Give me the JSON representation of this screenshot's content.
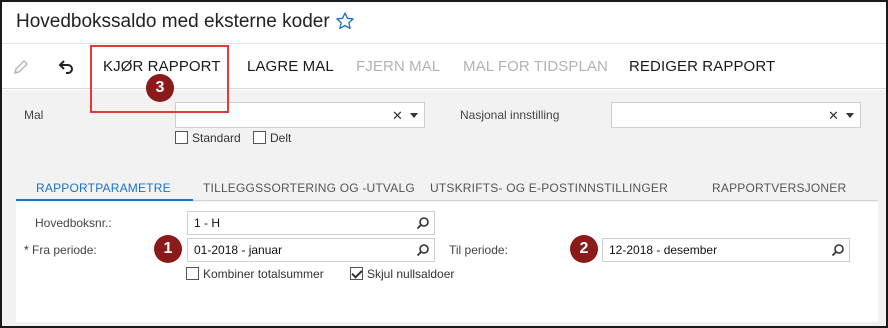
{
  "window": {
    "title": "Hovedbokssaldo med eksterne koder"
  },
  "toolbar": {
    "run_report": "KJØR RAPPORT",
    "save_template": "LAGRE MAL",
    "remove_template": "FJERN MAL",
    "schedule_template": "MAL FOR TIDSPLAN",
    "edit_report": "REDIGER RAPPORT"
  },
  "template_panel": {
    "template_label": "Mal",
    "template_value": "",
    "national_label": "Nasjonal innstilling",
    "national_value": "",
    "clear_symbol": "✕",
    "standard_label": "Standard",
    "shared_label": "Delt"
  },
  "tabs": [
    {
      "label": "RAPPORTPARAMETRE",
      "active": true
    },
    {
      "label": "TILLEGGSSORTERING OG -UTVALG",
      "active": false
    },
    {
      "label": "UTSKRIFTS- OG E-POSTINNSTILLINGER",
      "active": false
    },
    {
      "label": "RAPPORTVERSJONER",
      "active": false
    }
  ],
  "parameters": {
    "ledger_label": "Hovedboksnr.:",
    "ledger_value": "1 - H",
    "required_marker": "*",
    "from_period_label": "Fra periode:",
    "from_period_value": "01-2018 - januar",
    "to_period_label": "Til periode:",
    "to_period_value": "12-2018 - desember",
    "combine_totals_label": "Kombiner totalsummer",
    "combine_totals_checked": false,
    "hide_zero_label": "Skjul nullsaldoer",
    "hide_zero_checked": true
  },
  "annotations": {
    "badge_1": "1",
    "badge_2": "2",
    "badge_3": "3",
    "callout_color": "#e53935",
    "badge_color": "#8b1a1a"
  },
  "colors": {
    "accent": "#1a73c9",
    "disabled": "#b3b3b3",
    "panel_bg": "#f2f2f2"
  },
  "icons": {
    "favorite": "star-outline-icon",
    "edit": "pencil-icon",
    "undo": "undo-icon",
    "lookup": "magnifier-icon"
  }
}
